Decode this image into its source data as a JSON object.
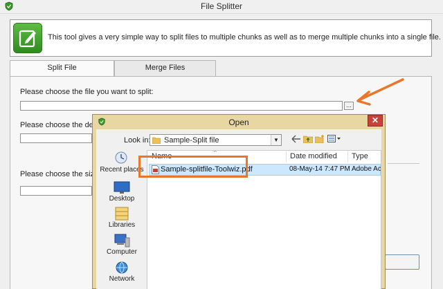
{
  "main_window": {
    "title": "File Splitter",
    "description": "This tool gives a very simple way to split files to multiple chunks as well as to merge multiple chunks into a single file.",
    "tabs": [
      {
        "label": "Split File",
        "active": true
      },
      {
        "label": "Merge Files",
        "active": false
      }
    ],
    "split_tab": {
      "choose_file_label": "Please choose the file you want to split:",
      "choose_file_value": "",
      "browse_label": "...",
      "destination_label": "Please choose the destinati",
      "destination_value": "",
      "size_label": "Please choose the size of t",
      "size_value": ""
    }
  },
  "open_dialog": {
    "title": "Open",
    "close_label": "✕",
    "look_in_label": "Look in:",
    "look_in_value": "Sample-Split file",
    "toolbar_icons": [
      "back-arrow-icon",
      "up-folder-icon",
      "new-folder-icon",
      "view-menu-icon"
    ],
    "places": [
      {
        "label": "Recent places",
        "icon": "recent-places-icon"
      },
      {
        "label": "Desktop",
        "icon": "desktop-icon"
      },
      {
        "label": "Libraries",
        "icon": "libraries-icon"
      },
      {
        "label": "Computer",
        "icon": "computer-icon"
      },
      {
        "label": "Network",
        "icon": "network-icon"
      }
    ],
    "columns": [
      "Name",
      "Date modified",
      "Type"
    ],
    "files": [
      {
        "name": "Sample-splitfile-Toolwiz.pdf",
        "date_modified": "08-May-14 7:47 PM",
        "type": "Adobe Ac",
        "selected": true
      }
    ]
  },
  "colors": {
    "annotation": "#e9762b",
    "selection": "#cce8ff",
    "dialog_frame": "#e8d6a3",
    "close_button": "#c9413a",
    "brand_green": "#3a9a2a"
  }
}
